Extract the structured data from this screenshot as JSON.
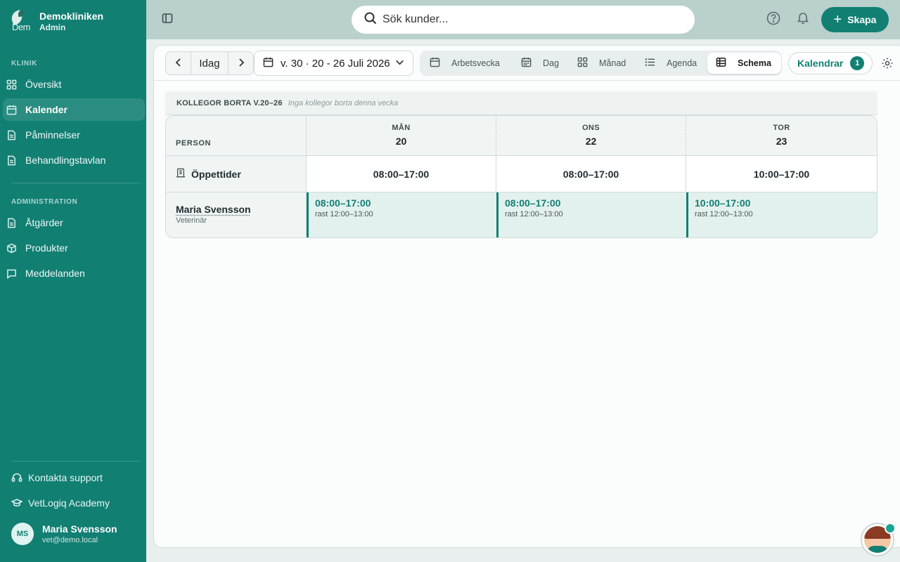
{
  "brand": {
    "logo_text": "Dem",
    "name": "Demokliniken",
    "role": "Admin"
  },
  "sidebar": {
    "section_klinik": "KLINIK",
    "klinik_items": [
      {
        "label": "Översikt",
        "icon": "grid-icon"
      },
      {
        "label": "Kalender",
        "icon": "calendar-icon",
        "active": true
      },
      {
        "label": "Påminnelser",
        "icon": "document-icon"
      },
      {
        "label": "Behandlingstavlan",
        "icon": "document-icon"
      }
    ],
    "section_admin": "ADMINISTRATION",
    "admin_items": [
      {
        "label": "Åtgärder",
        "icon": "document-icon"
      },
      {
        "label": "Produkter",
        "icon": "box-icon"
      },
      {
        "label": "Meddelanden",
        "icon": "message-icon"
      }
    ],
    "footer_items": [
      {
        "label": "Kontakta support",
        "icon": "headset-icon"
      },
      {
        "label": "VetLogiq Academy",
        "icon": "graduation-cap-icon"
      }
    ],
    "user": {
      "initials": "MS",
      "name": "Maria Svensson",
      "email": "vet@demo.local"
    }
  },
  "topbar": {
    "search_placeholder": "Sök kunder...",
    "create_label": "Skapa"
  },
  "toolbar": {
    "today_label": "Idag",
    "week_label": "v. 30 · 20 - 26 Juli 2026",
    "views": [
      {
        "label": "Arbetsvecka",
        "icon": "calendar-icon"
      },
      {
        "label": "Dag",
        "icon": "calendar-grid-icon"
      },
      {
        "label": "Månad",
        "icon": "grid-icon"
      },
      {
        "label": "Agenda",
        "icon": "list-icon"
      },
      {
        "label": "Schema",
        "icon": "table-icon",
        "active": true
      }
    ],
    "calendars_label": "Kalendrar",
    "calendars_count": "1"
  },
  "absence": {
    "title": "KOLLEGOR BORTA V.20–26",
    "note": "Inga kollegor borta denna vecka"
  },
  "schedule": {
    "person_header": "PERSON",
    "days": [
      {
        "name": "MÅN",
        "date": "20"
      },
      {
        "name": "ONS",
        "date": "22"
      },
      {
        "name": "TOR",
        "date": "23"
      }
    ],
    "opening_label": "Öppettider",
    "opening_times": [
      "08:00–17:00",
      "08:00–17:00",
      "10:00–17:00"
    ],
    "staff": {
      "name": "Maria Svensson",
      "role": "Veterinär",
      "shifts": [
        {
          "time": "08:00–17:00",
          "break": "rast 12:00–13:00"
        },
        {
          "time": "08:00–17:00",
          "break": "rast 12:00–13:00"
        },
        {
          "time": "10:00–17:00",
          "break": "rast 12:00–13:00"
        }
      ]
    }
  },
  "colors": {
    "brand": "#127f73",
    "topbar": "#b9d0cc",
    "shift_bg": "#e3f1ee"
  }
}
